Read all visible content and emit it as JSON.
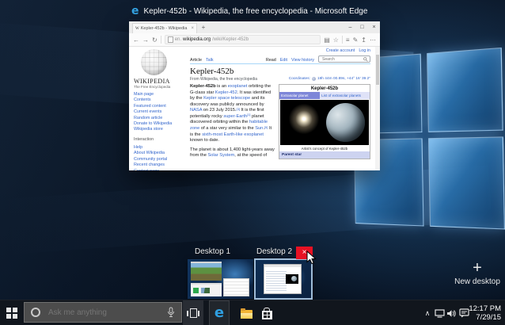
{
  "colors": {
    "close_red": "#e81123",
    "edge_blue": "#2f9fe0",
    "wiki_link": "#3366cc",
    "selected_border": "#9fbcd8"
  },
  "preview_header": {
    "title": "Kepler-452b - Wikipedia, the free encyclopedia - Microsoft Edge",
    "edge_logo": "e"
  },
  "edge": {
    "tab_title": "Kepler-452b - Wikipedia",
    "tab_favicon": "W",
    "tab_close": "×",
    "new_tab": "+",
    "window_controls": {
      "minimize": "–",
      "maximize": "□",
      "close": "×"
    },
    "icons": {
      "back": "←",
      "forward": "→",
      "refresh": "↻",
      "reading_view": "▤",
      "star": "☆",
      "hub": "≡",
      "note": "✎",
      "share": "↥",
      "more": "⋯"
    },
    "url_prefix": "en.",
    "url_domain": "wikipedia.org",
    "url_path": "/wiki/Kepler-452b"
  },
  "wiki": {
    "logo_title": "WIKIPEDIA",
    "logo_subtitle": "The Free Encyclopedia",
    "sidebar_links": [
      "Main page",
      "Contents",
      "Featured content",
      "Current events",
      "Random article",
      "Donate to Wikipedia",
      "Wikipedia store"
    ],
    "interaction_header": "Interaction",
    "interaction_links": [
      "Help",
      "About Wikipedia",
      "Community portal",
      "Recent changes",
      "Contact page"
    ],
    "page_tabs": [
      "Article",
      "Talk"
    ],
    "view_tabs": [
      "Read",
      "Edit",
      "View history"
    ],
    "search_placeholder": "Search",
    "account_links": [
      "Create account",
      "Log in"
    ],
    "title": "Kepler-452b",
    "subtitle": "From Wikipedia, the free encyclopedia",
    "coordinates_label": "Coordinates:",
    "coordinates_value": "19h 44m 00.89s, +44° 16′ 39.2″",
    "paragraph1": [
      {
        "t": "Kepler-452b",
        "b": 1
      },
      {
        "t": " is an "
      },
      {
        "t": "exoplanet",
        "l": 1
      },
      {
        "t": " orbiting the G-class star "
      },
      {
        "t": "Kepler-452",
        "l": 1
      },
      {
        "t": ". It was identified by the "
      },
      {
        "t": "Kepler space telescope",
        "l": 1
      },
      {
        "t": " and its discovery was publicly announced by "
      },
      {
        "t": "NASA",
        "l": 1
      },
      {
        "t": " on 23 July 2015."
      },
      {
        "t": "[3]",
        "l": 1,
        "s": 1
      },
      {
        "t": " It is the first potentially rocky "
      },
      {
        "t": "super-Earth",
        "l": 1
      },
      {
        "t": "[1]",
        "l": 1,
        "s": 1
      },
      {
        "t": " planet discovered orbiting within the "
      },
      {
        "t": "habitable zone",
        "l": 1
      },
      {
        "t": " of a star very similar to the "
      },
      {
        "t": "Sun",
        "l": 1
      },
      {
        "t": "."
      },
      {
        "t": "[5]",
        "l": 1,
        "s": 1
      },
      {
        "t": " It is the "
      },
      {
        "t": "sixth-most Earth-like exoplanet",
        "l": 1
      },
      {
        "t": " known to date."
      }
    ],
    "paragraph2": [
      {
        "t": "The planet is about 1,400 light-years away from the "
      },
      {
        "t": "Solar System",
        "l": 1
      },
      {
        "t": ", at the speed of"
      }
    ],
    "infobox": {
      "title": "Kepler-452b",
      "header_left": "Extrasolar planet",
      "header_right": "List of extrasolar planets",
      "caption": "Artist's concept of Kepler-452b",
      "section": "Parent star"
    }
  },
  "taskview": {
    "desktops": [
      {
        "label": "Desktop 1"
      },
      {
        "label": "Desktop 2"
      }
    ],
    "close_glyph": "×",
    "new_desktop_plus": "+",
    "new_desktop_label": "New desktop"
  },
  "taskbar": {
    "search_placeholder": "Ask me anything",
    "tray_chevron": "∧",
    "clock_time": "12:17 PM",
    "clock_date": "7/29/15"
  }
}
